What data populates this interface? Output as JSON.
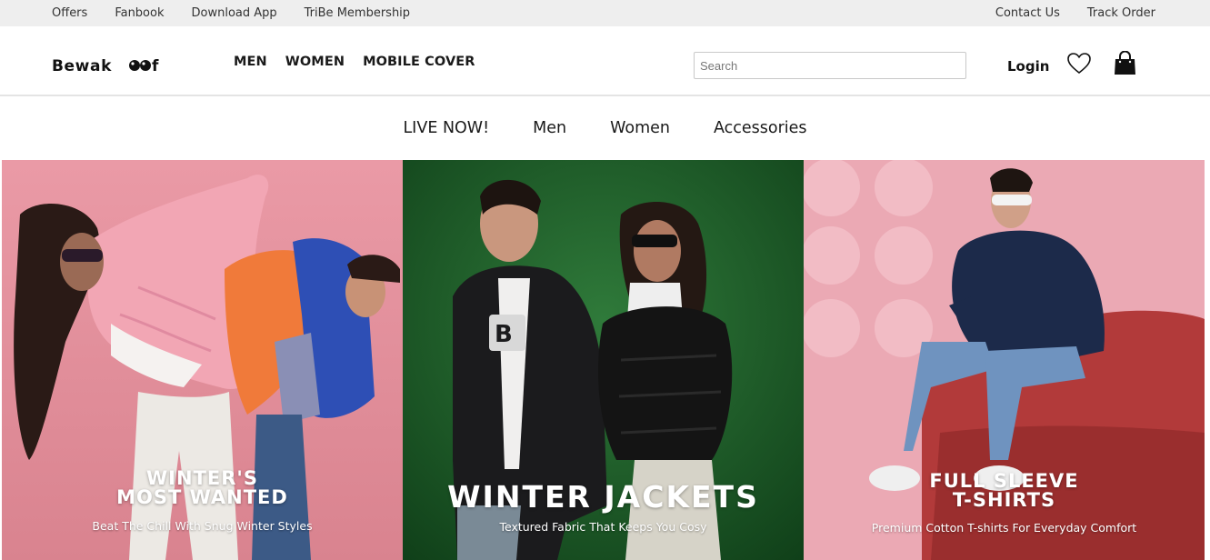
{
  "topbar": {
    "left_links": [
      "Offers",
      "Fanbook",
      "Download App",
      "TriBe Membership"
    ],
    "right_links": [
      "Contact Us",
      "Track Order"
    ]
  },
  "header": {
    "logo_text": "Bewakoof",
    "nav": [
      "MEN",
      "WOMEN",
      "MOBILE COVER"
    ],
    "search_placeholder": "Search",
    "login_label": "Login",
    "wishlist_icon": "heart-icon",
    "bag_icon": "shopping-bag-icon"
  },
  "category_nav": [
    "LIVE NOW!",
    "Men",
    "Women",
    "Accessories"
  ],
  "banners": [
    {
      "title": "WINTER'S\nMOST WANTED",
      "subtitle": "Beat The Chill With Snug Winter Styles",
      "bg": "#e8a0a8"
    },
    {
      "title": "WINTER JACKETS",
      "subtitle": "Textured Fabric That Keeps You Cosy",
      "bg": "#1f5a2a"
    },
    {
      "title": "FULL SLEEVE\nT-SHIRTS",
      "subtitle": "Premium Cotton T-shirts For Everyday Comfort",
      "bg": "#eba9b4"
    }
  ],
  "colors": {
    "topbar_bg": "#eeeeee",
    "text": "#1a1a1a",
    "banner_text": "#ffffff"
  }
}
